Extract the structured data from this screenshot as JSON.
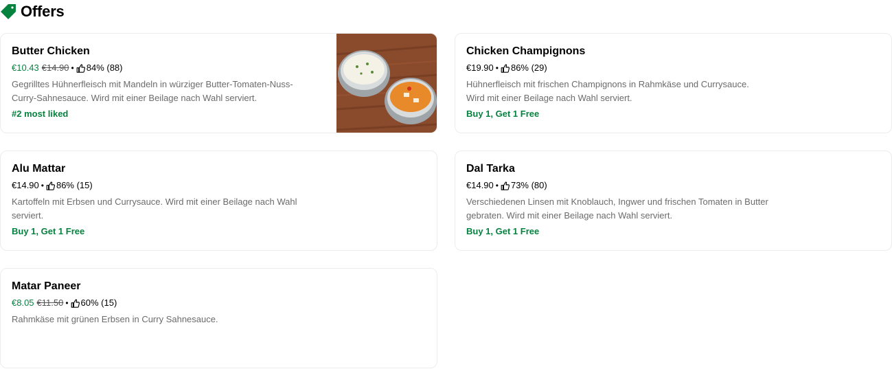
{
  "section": {
    "title": "Offers",
    "icon": "tag-icon"
  },
  "colors": {
    "accent_green": "#06823f",
    "muted_text": "#6b6b6b",
    "border": "#ececec"
  },
  "cards": [
    {
      "name": "Butter Chicken",
      "price": "€10.43",
      "old_price": "€14.90",
      "separator": "•",
      "rating": "84% (88)",
      "description": "Gegrilltes Hühnerfleisch mit Mandeln in würziger Butter-Tomaten-Nuss-Curry-Sahnesauce. Wird mit einer Beilage nach Wahl serviert.",
      "badge": "#2 most liked",
      "image": "food-photo"
    },
    {
      "name": "Chicken Champignons",
      "price": "€19.90",
      "separator": "•",
      "rating": "86% (29)",
      "description": "Hühnerfleisch mit frischen Champignons in Rahmkäse und Currysauce. Wird mit einer Beilage nach Wahl serviert.",
      "badge": "Buy 1, Get 1 Free"
    },
    {
      "name": "Alu Mattar",
      "price": "€14.90",
      "separator": "•",
      "rating": "86% (15)",
      "description": "Kartoffeln mit Erbsen und Currysauce. Wird mit einer Beilage nach Wahl serviert.",
      "badge": "Buy 1, Get 1 Free"
    },
    {
      "name": "Dal Tarka",
      "price": "€14.90",
      "separator": "•",
      "rating": "73% (80)",
      "description": "Verschiedenen Linsen mit Knoblauch, Ingwer und frischen Tomaten in Butter gebraten. Wird mit einer Beilage nach Wahl serviert.",
      "badge": "Buy 1, Get 1 Free"
    },
    {
      "name": "Matar Paneer",
      "price": "€8.05",
      "old_price": "€11.50",
      "separator": "•",
      "rating": "60% (15)",
      "description": "Rahmkäse mit grünen Erbsen in Curry Sahnesauce."
    }
  ]
}
